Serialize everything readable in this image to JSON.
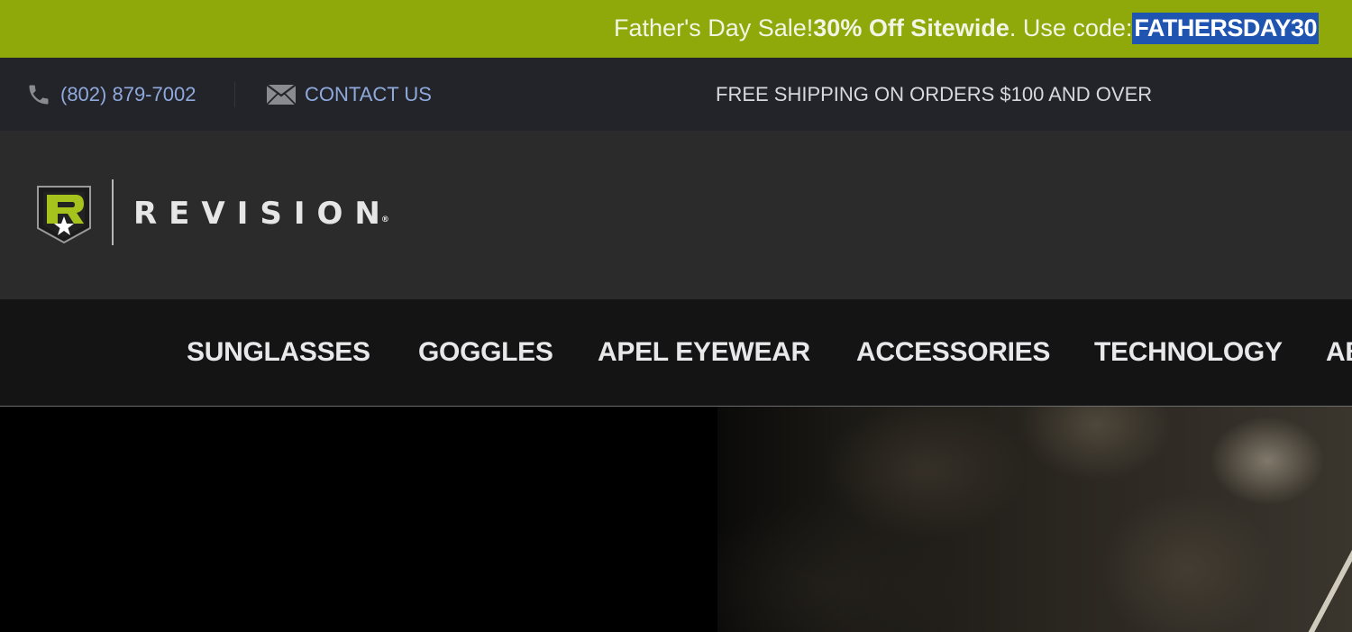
{
  "promo": {
    "intro": "Father's Day Sale! ",
    "highlight": "30% Off Sitewide",
    "after": ". Use code: ",
    "code": "FATHERSDAY30"
  },
  "utility": {
    "phone": "(802) 879-7002",
    "contact": "CONTACT US",
    "shipping": "FREE SHIPPING ON ORDERS $100 AND OVER"
  },
  "brand": {
    "name": "REVISION",
    "reg": "®",
    "accent_color": "#8fa80a"
  },
  "nav": {
    "items": [
      {
        "label": "SUNGLASSES"
      },
      {
        "label": "GOGGLES"
      },
      {
        "label": "APEL EYEWEAR"
      },
      {
        "label": "ACCESSORIES"
      },
      {
        "label": "TECHNOLOGY"
      },
      {
        "label": "AB"
      }
    ]
  },
  "icons": {
    "phone": "phone-icon",
    "contact": "envelope-icon"
  }
}
